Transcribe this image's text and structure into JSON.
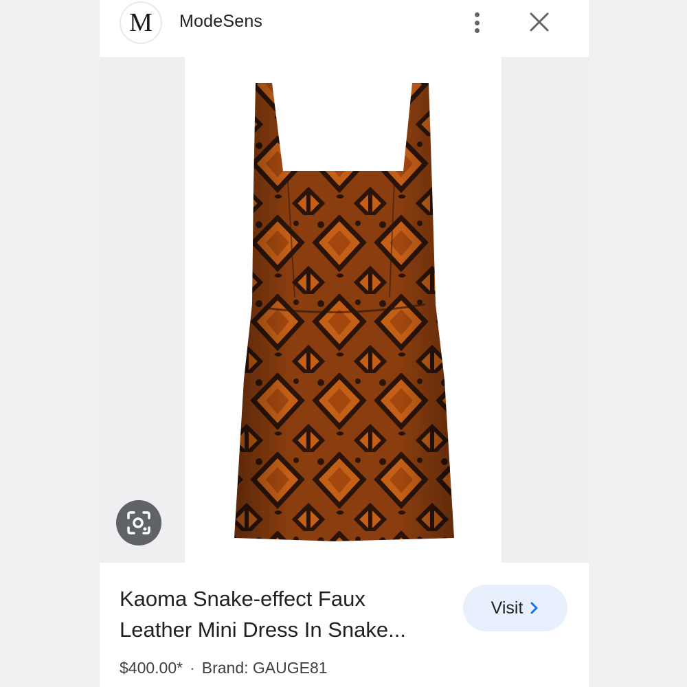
{
  "header": {
    "logo_letter": "M",
    "site_name": "ModeSens"
  },
  "icons": {
    "more": "more-vert-icon",
    "close": "close-icon",
    "lens": "google-lens-icon",
    "visit_arrow": "chevron-right-icon"
  },
  "product": {
    "title_line1": "Kaoma Snake-effect Faux",
    "title_line2": "Leather Mini Dress In Snake...",
    "price": "$400.00*",
    "separator": "·",
    "brand": "Brand: GAUGE81",
    "image_alt": "Snake print mini dress"
  },
  "actions": {
    "visit_label": "Visit"
  },
  "colors": {
    "visit_bg": "#e8f0fe",
    "chevron": "#1a73e8",
    "dress_base": "#8a3d0f",
    "dress_dark": "#2a140a"
  }
}
